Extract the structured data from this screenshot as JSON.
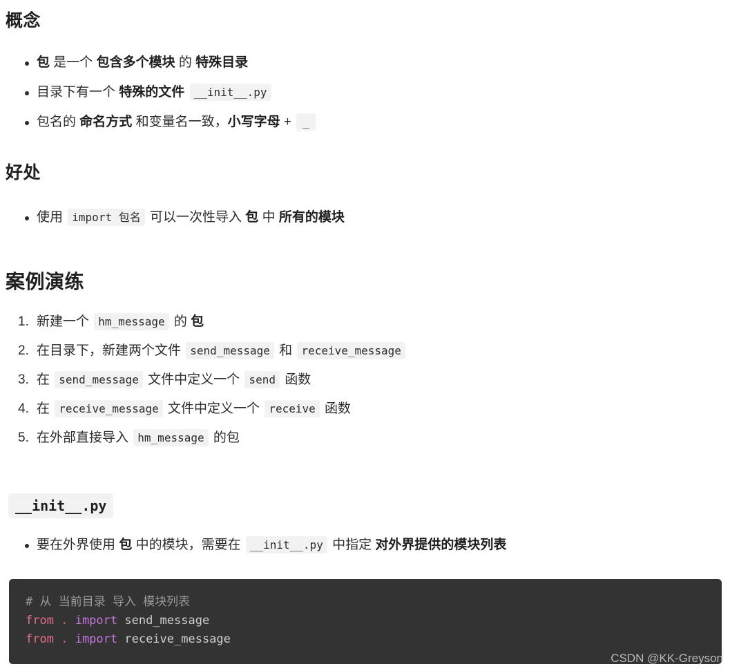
{
  "sections": {
    "concept": {
      "heading": "概念",
      "items": [
        {
          "parts": [
            {
              "t": "bold",
              "v": "包"
            },
            {
              "t": "text",
              "v": " 是一个 "
            },
            {
              "t": "bold",
              "v": "包含多个模块"
            },
            {
              "t": "text",
              "v": " 的 "
            },
            {
              "t": "bold",
              "v": "特殊目录"
            }
          ]
        },
        {
          "parts": [
            {
              "t": "text",
              "v": "目录下有一个 "
            },
            {
              "t": "bold",
              "v": "特殊的文件"
            },
            {
              "t": "text",
              "v": " "
            },
            {
              "t": "code",
              "v": "__init__.py"
            }
          ]
        },
        {
          "parts": [
            {
              "t": "text",
              "v": "包名的 "
            },
            {
              "t": "bold",
              "v": "命名方式"
            },
            {
              "t": "text",
              "v": " 和变量名一致，"
            },
            {
              "t": "bold",
              "v": "小写字母"
            },
            {
              "t": "text",
              "v": " + "
            },
            {
              "t": "code",
              "v": "_"
            }
          ]
        }
      ]
    },
    "benefit": {
      "heading": "好处",
      "items": [
        {
          "parts": [
            {
              "t": "text",
              "v": "使用 "
            },
            {
              "t": "code",
              "v": "import 包名"
            },
            {
              "t": "text",
              "v": " 可以一次性导入 "
            },
            {
              "t": "bold",
              "v": "包"
            },
            {
              "t": "text",
              "v": " 中 "
            },
            {
              "t": "bold",
              "v": "所有的模块"
            }
          ]
        }
      ]
    },
    "practice": {
      "heading": "案例演练",
      "steps": [
        {
          "num": "1.",
          "parts": [
            {
              "t": "text",
              "v": "新建一个 "
            },
            {
              "t": "code",
              "v": "hm_message"
            },
            {
              "t": "text",
              "v": " 的 "
            },
            {
              "t": "bold",
              "v": "包"
            }
          ]
        },
        {
          "num": "2.",
          "parts": [
            {
              "t": "text",
              "v": "在目录下，新建两个文件 "
            },
            {
              "t": "code",
              "v": "send_message"
            },
            {
              "t": "text",
              "v": " 和 "
            },
            {
              "t": "code",
              "v": "receive_message"
            }
          ]
        },
        {
          "num": "3.",
          "parts": [
            {
              "t": "text",
              "v": "在 "
            },
            {
              "t": "code",
              "v": "send_message"
            },
            {
              "t": "text",
              "v": " 文件中定义一个 "
            },
            {
              "t": "code",
              "v": "send"
            },
            {
              "t": "text",
              "v": " 函数"
            }
          ]
        },
        {
          "num": "4.",
          "parts": [
            {
              "t": "text",
              "v": "在 "
            },
            {
              "t": "code",
              "v": "receive_message"
            },
            {
              "t": "text",
              "v": " 文件中定义一个 "
            },
            {
              "t": "code",
              "v": "receive"
            },
            {
              "t": "text",
              "v": " 函数"
            }
          ]
        },
        {
          "num": "5.",
          "parts": [
            {
              "t": "text",
              "v": "在外部直接导入 "
            },
            {
              "t": "code",
              "v": "hm_message"
            },
            {
              "t": "text",
              "v": " 的包"
            }
          ]
        }
      ]
    },
    "init": {
      "heading_code": "__init__.py",
      "items": [
        {
          "parts": [
            {
              "t": "text",
              "v": "要在外界使用 "
            },
            {
              "t": "bold",
              "v": "包"
            },
            {
              "t": "text",
              "v": " 中的模块，需要在 "
            },
            {
              "t": "code",
              "v": "__init__.py"
            },
            {
              "t": "text",
              "v": " 中指定 "
            },
            {
              "t": "bold",
              "v": "对外界提供的模块列表"
            }
          ]
        }
      ]
    }
  },
  "code_block": {
    "language": "python",
    "lines": [
      [
        {
          "tok": "comment",
          "v": "# 从 当前目录 导入 模块列表"
        }
      ],
      [
        {
          "tok": "kw",
          "v": "from"
        },
        {
          "tok": "name",
          "v": " "
        },
        {
          "tok": "punct",
          "v": "."
        },
        {
          "tok": "name",
          "v": " "
        },
        {
          "tok": "kw2",
          "v": "import"
        },
        {
          "tok": "name",
          "v": " send_message"
        }
      ],
      [
        {
          "tok": "kw",
          "v": "from"
        },
        {
          "tok": "name",
          "v": " "
        },
        {
          "tok": "punct",
          "v": "."
        },
        {
          "tok": "name",
          "v": " "
        },
        {
          "tok": "kw2",
          "v": "import"
        },
        {
          "tok": "name",
          "v": " receive_message"
        }
      ]
    ],
    "colors": {
      "background": "#333333",
      "comment": "#9a9a9a",
      "keyword": "#e76f8a",
      "keyword_alt": "#c678dd",
      "punct": "#e06c75",
      "identifier": "#cfcfcf"
    }
  },
  "watermark": {
    "text": "CSDN @KK-Greyson"
  },
  "theme": {
    "page_background": "#ffffff",
    "body_text": "#2c2c2c",
    "heading_text": "#1f1f1f",
    "inline_code_background": "#f2f2f2"
  }
}
